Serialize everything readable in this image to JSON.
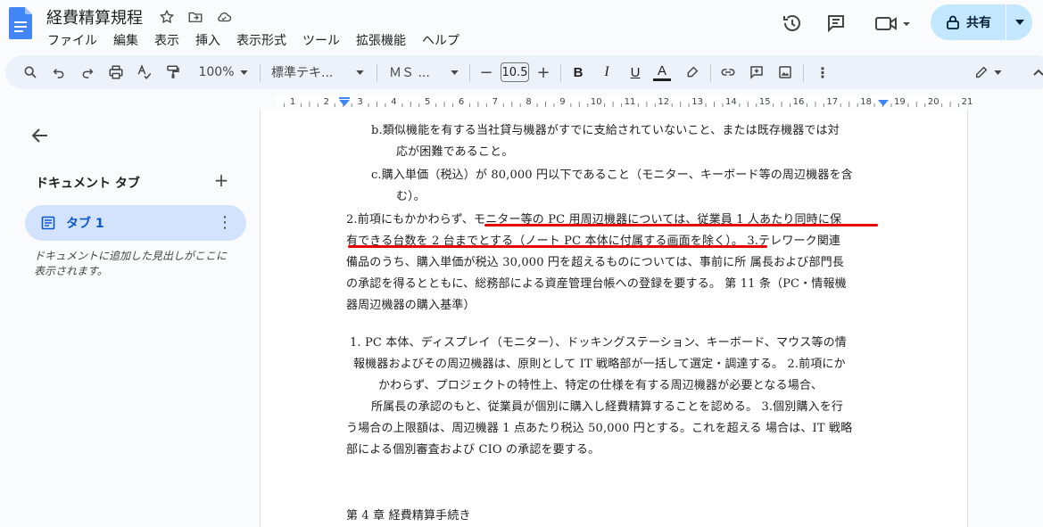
{
  "doc": {
    "title": "経費精算規程"
  },
  "menu": [
    "ファイル",
    "編集",
    "表示",
    "挿入",
    "表示形式",
    "ツール",
    "拡張機能",
    "ヘルプ"
  ],
  "share": {
    "label": "共有"
  },
  "toolbar": {
    "zoom": "100%",
    "style": "標準テキ...",
    "font": "ＭＳ ...",
    "font_size": "10.5"
  },
  "ruler": {
    "ticks": [
      "1",
      "2",
      "3",
      "4",
      "5",
      "6",
      "7",
      "8",
      "9",
      "10",
      "11",
      "12",
      "13",
      "14",
      "15",
      "16",
      "17",
      "18",
      "19",
      "20",
      "21"
    ]
  },
  "sidepanel": {
    "heading": "ドキュメント タブ",
    "tab_label": "タブ 1",
    "hint": "ドキュメントに追加した見出しがここに表示されます。"
  },
  "document": {
    "lines": [
      "b.類似機能を有する当社貸与機器がすでに支給されていないこと、または既存機器では対",
      "応が困難であること。",
      "c.購入単価（税込）が 80,000 円以下であること（モニター、キーボード等の周辺機器を含",
      "む）。",
      "2.前項にもかかわらず、モニター等の PC 用周辺機器については、従業員 1 人あたり同時に保",
      "有できる台数を 2 台までとする（ノート PC 本体に付属する画面を除く）。 3.テレワーク関連",
      "備品のうち、購入単価が税込 30,000 円を超えるものについては、事前に所 属長および部門長",
      "の承認を得るとともに、総務部による資産管理台帳への登録を要する。 第 11 条（PC・情報機",
      "器周辺機器の購入基準）",
      "1. PC 本体、ディスプレイ（モニター）、ドッキングステーション、キーボード、マウス等の情",
      "報機器およびその周辺機器は、原則として IT 戦略部が一括して選定・調達する。 2.前項にか",
      "かわらず、プロジェクトの特性上、特定の仕様を有する周辺機器が必要となる場合、",
      "所属長の承認のもと、従業員が個別に購入し経費精算することを認める。 3.個別購入を行",
      "う場合の上限額は、周辺機器 1 点あたり税込 50,000 円とする。これを超える 場合は、IT 戦略",
      "部による個別審査および CIO の承認を要する。",
      "第 4 章 経費精算手続き"
    ]
  }
}
